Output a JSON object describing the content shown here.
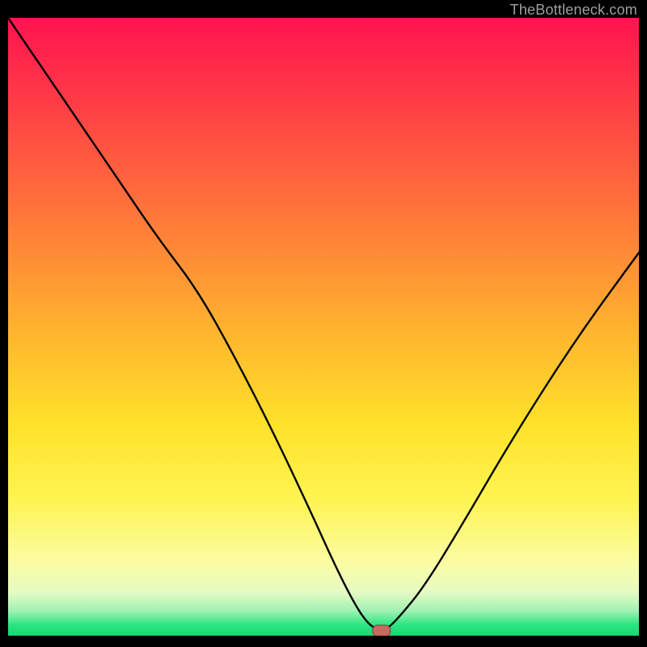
{
  "watermark": "TheBottleneck.com",
  "colors": {
    "curve_stroke": "#000000",
    "marker_fill": "#c96a5f",
    "marker_stroke": "#7a3b34"
  },
  "chart_data": {
    "type": "line",
    "title": "",
    "xlabel": "",
    "ylabel": "",
    "xlim": [
      0,
      100
    ],
    "ylim": [
      0,
      100
    ],
    "grid": false,
    "legend": false,
    "series": [
      {
        "name": "bottleneck-curve",
        "x": [
          0,
          6,
          12,
          18,
          24,
          30,
          36,
          42,
          48,
          52,
          55,
          57,
          58.5,
          60,
          62,
          66,
          72,
          80,
          90,
          100
        ],
        "values": [
          100,
          91,
          82,
          73,
          64,
          56,
          45,
          33,
          20,
          11,
          5,
          2,
          1,
          1,
          3,
          8,
          18,
          32,
          48,
          62
        ]
      }
    ],
    "marker": {
      "x": 59.2,
      "y": 0.8,
      "rx": 1.4,
      "ry": 0.9
    }
  }
}
